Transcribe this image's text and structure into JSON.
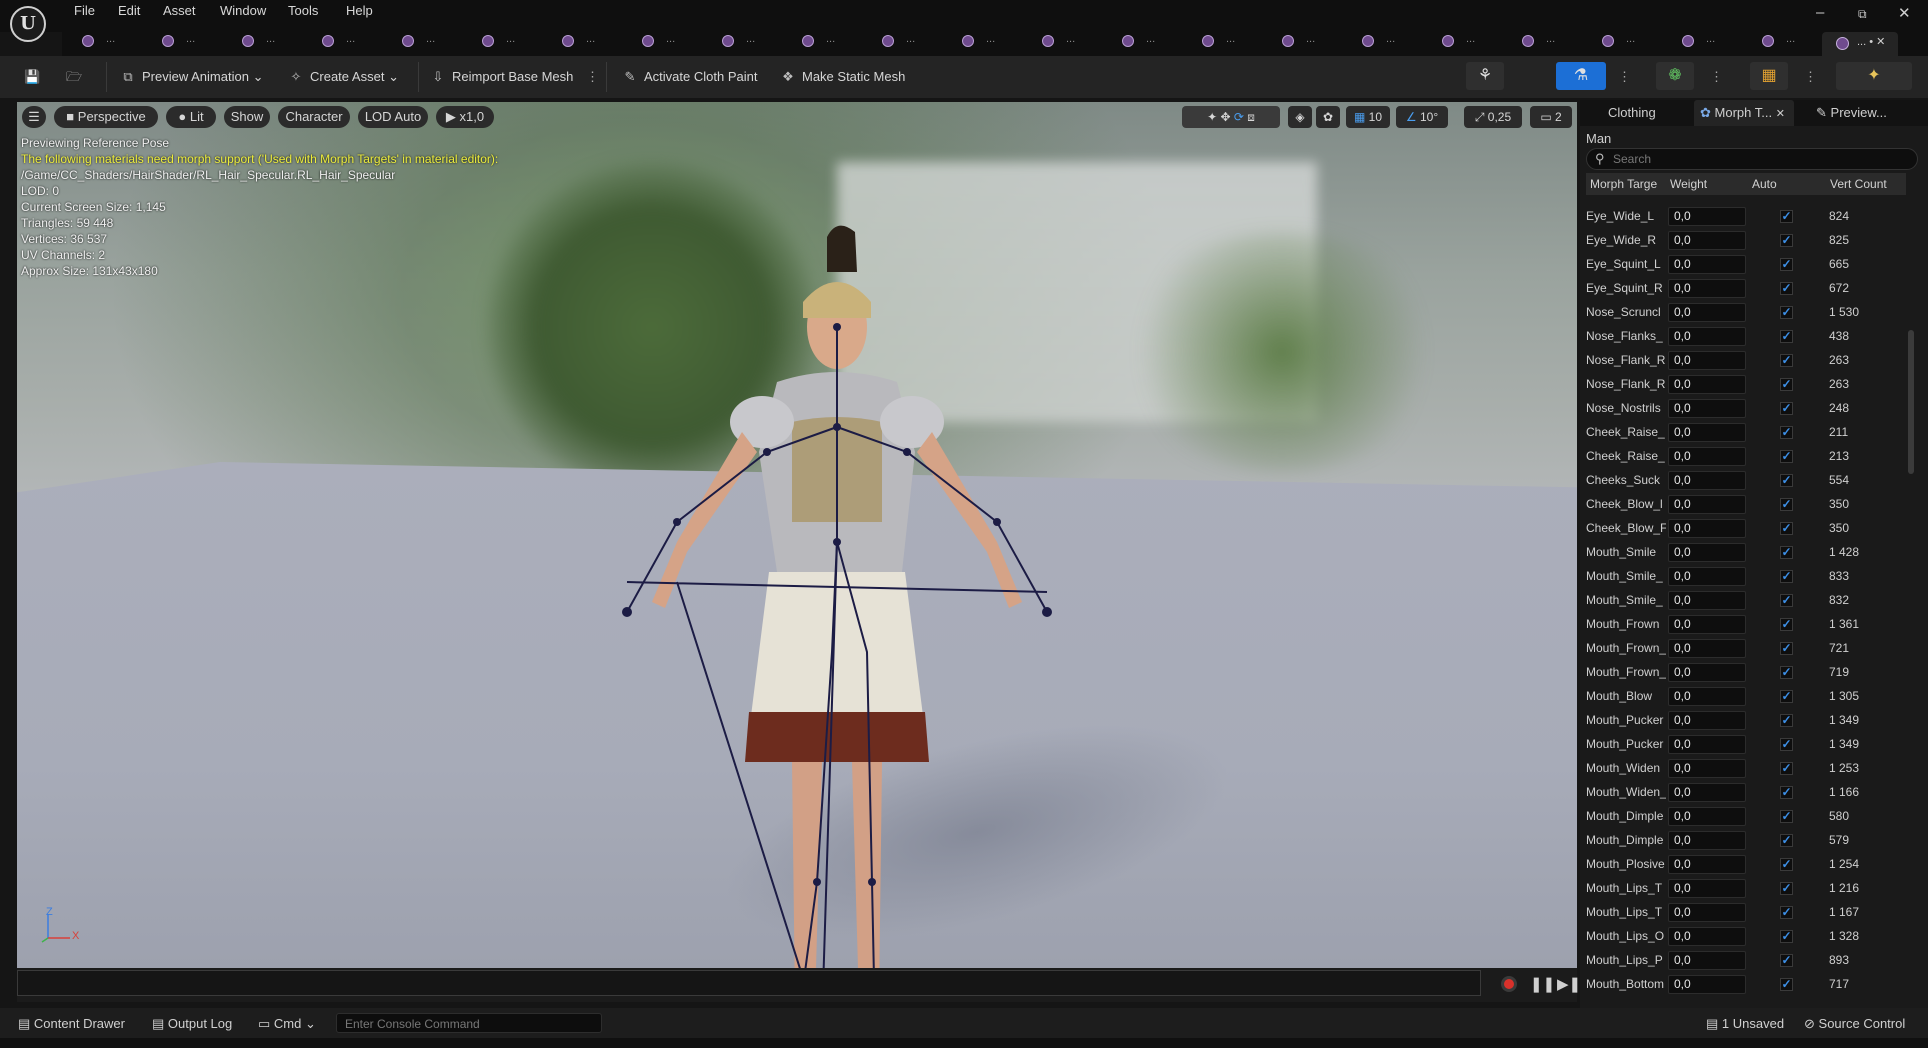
{
  "menu": {
    "items": [
      "File",
      "Edit",
      "Asset",
      "Window",
      "Tools",
      "Help"
    ]
  },
  "window_controls": {
    "minimize": "–",
    "restore": "⧉",
    "close": "✕"
  },
  "doc_tabs": {
    "ellipsis": "...",
    "active_label": "... • ✕"
  },
  "toolbar": {
    "preview_animation": "Preview Animation",
    "create_asset": "Create Asset",
    "reimport_base_mesh": "Reimport Base Mesh",
    "activate_cloth_paint": "Activate Cloth Paint",
    "make_static_mesh": "Make Static Mesh"
  },
  "viewport": {
    "perspective": "Perspective",
    "lit": "Lit",
    "show": "Show",
    "character": "Character",
    "lod_auto": "LOD Auto",
    "play_speed": "x1,0",
    "grid_snap": "10",
    "rotation_snap": "10°",
    "scale_snap": "0,25",
    "camera_speed": "2",
    "axis_z": "Z",
    "axis_x": "X",
    "info": {
      "pose": "Previewing Reference Pose",
      "warning": "The following materials need morph support ('Used with Morph Targets' in material editor):",
      "material_path": "/Game/CC_Shaders/HairShader/RL_Hair_Specular.RL_Hair_Specular",
      "lod": "LOD: 0",
      "screen_size": "Current Screen Size: 1,145",
      "triangles": "Triangles: 59 448",
      "vertices": "Vertices: 36 537",
      "uv_channels": "UV Channels: 2",
      "approx_size": "Approx Size: 131x43x180"
    }
  },
  "bottom_bar": {
    "content_drawer": "Content Drawer",
    "output_log": "Output Log",
    "cmd": "Cmd",
    "console_placeholder": "Enter Console Command",
    "unsaved": "1 Unsaved",
    "source_control": "Source Control"
  },
  "right_panel": {
    "tabs": [
      "Clothing",
      "Morph T...",
      "Preview..."
    ],
    "mesh_name": "Man",
    "search_placeholder": "Search",
    "columns": [
      "Morph Targe",
      "Weight",
      "Auto",
      "Vert Count"
    ],
    "rows": [
      {
        "name": "Eye_Wide_L",
        "weight": "0,0",
        "auto": true,
        "verts": "824"
      },
      {
        "name": "Eye_Wide_R",
        "weight": "0,0",
        "auto": true,
        "verts": "825"
      },
      {
        "name": "Eye_Squint_L",
        "weight": "0,0",
        "auto": true,
        "verts": "665"
      },
      {
        "name": "Eye_Squint_R",
        "weight": "0,0",
        "auto": true,
        "verts": "672"
      },
      {
        "name": "Nose_Scruncl",
        "weight": "0,0",
        "auto": true,
        "verts": "1 530"
      },
      {
        "name": "Nose_Flanks_",
        "weight": "0,0",
        "auto": true,
        "verts": "438"
      },
      {
        "name": "Nose_Flank_R",
        "weight": "0,0",
        "auto": true,
        "verts": "263"
      },
      {
        "name": "Nose_Flank_R",
        "weight": "0,0",
        "auto": true,
        "verts": "263"
      },
      {
        "name": "Nose_Nostrils",
        "weight": "0,0",
        "auto": true,
        "verts": "248"
      },
      {
        "name": "Cheek_Raise_",
        "weight": "0,0",
        "auto": true,
        "verts": "211"
      },
      {
        "name": "Cheek_Raise_",
        "weight": "0,0",
        "auto": true,
        "verts": "213"
      },
      {
        "name": "Cheeks_Suck",
        "weight": "0,0",
        "auto": true,
        "verts": "554"
      },
      {
        "name": "Cheek_Blow_l",
        "weight": "0,0",
        "auto": true,
        "verts": "350"
      },
      {
        "name": "Cheek_Blow_F",
        "weight": "0,0",
        "auto": true,
        "verts": "350"
      },
      {
        "name": "Mouth_Smile",
        "weight": "0,0",
        "auto": true,
        "verts": "1 428"
      },
      {
        "name": "Mouth_Smile_",
        "weight": "0,0",
        "auto": true,
        "verts": "833"
      },
      {
        "name": "Mouth_Smile_",
        "weight": "0,0",
        "auto": true,
        "verts": "832"
      },
      {
        "name": "Mouth_Frown",
        "weight": "0,0",
        "auto": true,
        "verts": "1 361"
      },
      {
        "name": "Mouth_Frown_",
        "weight": "0,0",
        "auto": true,
        "verts": "721"
      },
      {
        "name": "Mouth_Frown_",
        "weight": "0,0",
        "auto": true,
        "verts": "719"
      },
      {
        "name": "Mouth_Blow",
        "weight": "0,0",
        "auto": true,
        "verts": "1 305"
      },
      {
        "name": "Mouth_Pucker",
        "weight": "0,0",
        "auto": true,
        "verts": "1 349"
      },
      {
        "name": "Mouth_Pucker",
        "weight": "0,0",
        "auto": true,
        "verts": "1 349"
      },
      {
        "name": "Mouth_Widen",
        "weight": "0,0",
        "auto": true,
        "verts": "1 253"
      },
      {
        "name": "Mouth_Widen_",
        "weight": "0,0",
        "auto": true,
        "verts": "1 166"
      },
      {
        "name": "Mouth_Dimple",
        "weight": "0,0",
        "auto": true,
        "verts": "580"
      },
      {
        "name": "Mouth_Dimple",
        "weight": "0,0",
        "auto": true,
        "verts": "579"
      },
      {
        "name": "Mouth_Plosive",
        "weight": "0,0",
        "auto": true,
        "verts": "1 254"
      },
      {
        "name": "Mouth_Lips_T",
        "weight": "0,0",
        "auto": true,
        "verts": "1 216"
      },
      {
        "name": "Mouth_Lips_T",
        "weight": "0,0",
        "auto": true,
        "verts": "1 167"
      },
      {
        "name": "Mouth_Lips_O",
        "weight": "0,0",
        "auto": true,
        "verts": "1 328"
      },
      {
        "name": "Mouth_Lips_P",
        "weight": "0,0",
        "auto": true,
        "verts": "893"
      },
      {
        "name": "Mouth_Bottom",
        "weight": "0,0",
        "auto": true,
        "verts": "717"
      }
    ]
  },
  "colors": {
    "accent_blue": "#1c6fd6",
    "warning_yellow": "#ecec3c",
    "record_red": "#d9312b"
  }
}
